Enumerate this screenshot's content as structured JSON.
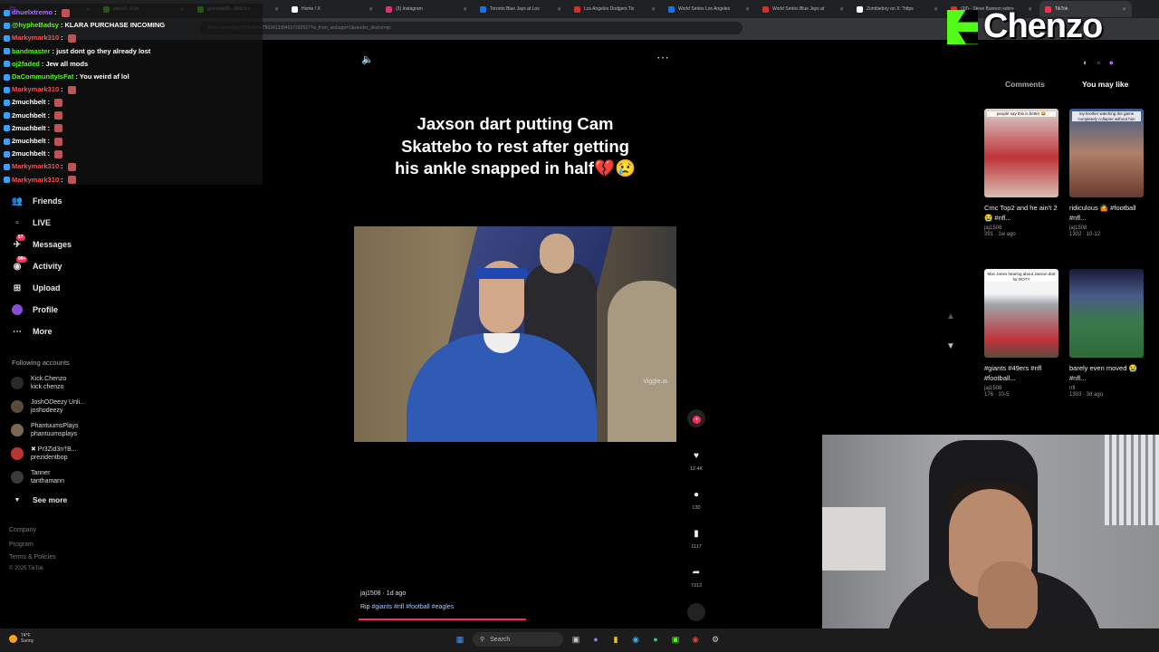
{
  "browser": {
    "tabs": [
      {
        "title": "",
        "color": "#9146ff"
      },
      {
        "title": "jaxtrc0 - Kick",
        "color": "#53fc18"
      },
      {
        "title": "gootmad09 - Watch c",
        "color": "#53fc18"
      },
      {
        "title": "Home / X",
        "color": "#ffffff"
      },
      {
        "title": "(3) Instagram",
        "color": "#e1306c"
      },
      {
        "title": "Toronto Blue Jays at Los",
        "color": "#1a73e8"
      },
      {
        "title": "Los Angeles Dodgers Tix",
        "color": "#d93025"
      },
      {
        "title": "World Series Los Angeles",
        "color": "#1a73e8"
      },
      {
        "title": "World Series Blue Jays at",
        "color": "#d93025"
      },
      {
        "title": "Zombieboy on X: \"https",
        "color": "#ffffff"
      },
      {
        "title": "(39) - Steve Bannon sobre",
        "color": "#d93025"
      },
      {
        "title": "TikTok",
        "color": "#fe2c55"
      }
    ],
    "address": "tiktok.com/@jaj1508/video/7563413384637232527?is_from_webapp=1&sender_device=pc"
  },
  "chat": [
    {
      "user": "dhuelxtremo",
      "msg": "",
      "color": "#a970ff"
    },
    {
      "user": "@hypheBadsy",
      "msg": "KLARA PURCHASE INCOMING",
      "color": "#53fc18"
    },
    {
      "user": "Markymark310",
      "msg": "",
      "color": "#ff4d4d"
    },
    {
      "user": "bandmaster",
      "msg": "just dont go they already lost",
      "color": "#53fc18"
    },
    {
      "user": "oj2faded",
      "msg": "Jew all mods",
      "color": "#53fc18"
    },
    {
      "user": "DaCommunityIsFat",
      "msg": "You weird af lol",
      "color": "#53fc18"
    },
    {
      "user": "Markymark310",
      "msg": "",
      "color": "#ff4d4d"
    },
    {
      "user": "2muchbelt",
      "msg": "",
      "color": "#ffffff"
    },
    {
      "user": "2muchbelt",
      "msg": "",
      "color": "#ffffff"
    },
    {
      "user": "2muchbelt",
      "msg": "",
      "color": "#ffffff"
    },
    {
      "user": "2muchbelt",
      "msg": "",
      "color": "#ffffff"
    },
    {
      "user": "2muchbelt",
      "msg": "",
      "color": "#ffffff"
    },
    {
      "user": "Markymark310",
      "msg": "",
      "color": "#ff4d4d"
    },
    {
      "user": "Markymark310",
      "msg": "",
      "color": "#ff4d4d"
    }
  ],
  "sidebar": {
    "nav": [
      {
        "label": "Friends",
        "icon": "friends-icon",
        "badge": ""
      },
      {
        "label": "LIVE",
        "icon": "live-icon",
        "badge": ""
      },
      {
        "label": "Messages",
        "icon": "messages-icon",
        "badge": "57"
      },
      {
        "label": "Activity",
        "icon": "activity-icon",
        "badge": "99+"
      },
      {
        "label": "Upload",
        "icon": "upload-icon",
        "badge": ""
      },
      {
        "label": "Profile",
        "icon": "profile-icon",
        "badge": ""
      },
      {
        "label": "More",
        "icon": "more-icon",
        "badge": ""
      }
    ],
    "following_title": "Following accounts",
    "accounts": [
      {
        "name": "Kick.Chenzo",
        "handle": "kick.chenzo",
        "color": "#2a2a2a"
      },
      {
        "name": "JoshODeezy Unli...",
        "handle": "joshodeezy",
        "color": "#5a4a3a"
      },
      {
        "name": "PhantuumsPlays",
        "handle": "phantuumsplays",
        "color": "#7a6a50"
      },
      {
        "name": "✖ Pr3Zid3n†B...",
        "handle": "prezidentbop",
        "color": "#b33"
      },
      {
        "name": "Tanner",
        "handle": "tanthamann",
        "color": "#3a3a3a"
      }
    ],
    "see_more": "See more",
    "footer": [
      "Company",
      "Program",
      "Terms & Policies",
      "© 2025 TikTok"
    ]
  },
  "video": {
    "caption": "Jaxson dart putting Cam Skattebo to rest after getting his ankle snapped in half💔😢",
    "watermark": "Viggle.ai",
    "author": "jaj1508 · 1d ago",
    "rip": "Rip",
    "tags": [
      "#giants",
      "#nfl",
      "#football",
      "#eagles"
    ],
    "progress": 0.52
  },
  "actions": {
    "likes": "12.4K",
    "comments": "130",
    "saves": "1117",
    "shares": "7313"
  },
  "right_panel": {
    "tab_comments": "Comments",
    "tab_you_may_like": "You may like",
    "cards": [
      {
        "caption": "people say this is better 😂",
        "title": "Cmc Top2 and he ain't 2 😭 #nfl...",
        "author": "jaj1508",
        "stats": "391 · 1w ago",
        "color": "#c0333a"
      },
      {
        "caption": "my brother watching the game completely collapse without him",
        "title": "ridiculous 🤷 #football #nfl...",
        "author": "jaj1508",
        "stats": "1302 · 10-12",
        "color": "#7a3b2e"
      },
      {
        "caption": "Mac Jones hearing about Jaxson dart for ROTY",
        "title": "#giants #49ers #nfl #football...",
        "author": "jaj1508",
        "stats": "176 · 10-5",
        "color": "#9a2f2f"
      },
      {
        "caption": "",
        "title": "barely even moved 😭 #nfl...",
        "author": "nfl",
        "stats": "1303 · 3d ago",
        "color": "#2f5a3a"
      }
    ]
  },
  "brand": {
    "name": "Chenzo",
    "color": "#53fc18"
  },
  "taskbar": {
    "weather_temp": "74°F",
    "weather_desc": "Sunny",
    "search_placeholder": "Search"
  }
}
